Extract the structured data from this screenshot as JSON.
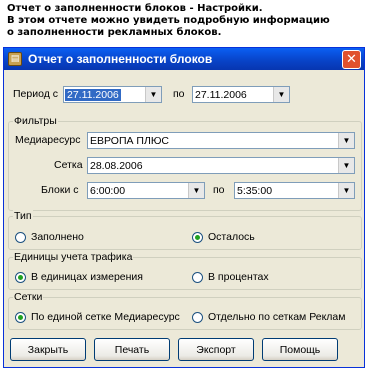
{
  "intro": {
    "line1": "Отчет о заполненности блоков - Настройки.",
    "line2": "В этом отчете можно увидеть подробную информацию",
    "line3": "о заполненности рекламных блоков."
  },
  "window": {
    "title": "Отчет о заполненности блоков",
    "close_glyph": "✕"
  },
  "period": {
    "label_from": "Период с",
    "from_value": "27.11.2006",
    "label_to": "по",
    "to_value": "27.11.2006"
  },
  "filters": {
    "title": "Фильтры",
    "media_label": "Медиаресурс",
    "media_value": "ЕВРОПА ПЛЮС",
    "grid_label": "Сетка",
    "grid_value": "28.08.2006",
    "blocks_label": "Блоки с",
    "blocks_from": "6:00:00",
    "blocks_to_label": "по",
    "blocks_to": "5:35:00"
  },
  "type": {
    "title": "Тип",
    "opt1": "Заполнено",
    "opt2": "Осталось",
    "selected": 2
  },
  "units": {
    "title": "Единицы учета трафика",
    "opt1": "В единицах измерения",
    "opt2": "В процентах",
    "selected": 1
  },
  "grids": {
    "title": "Сетки",
    "opt1": "По единой сетке Медиаресурс",
    "opt2": "Отдельно по сеткам Реклам",
    "selected": 1
  },
  "buttons": {
    "close": "Закрыть",
    "print": "Печать",
    "export": "Экспорт",
    "help": "Помощь"
  },
  "icons": {
    "dropdown": "chevron-down-icon",
    "app": "report-icon"
  }
}
